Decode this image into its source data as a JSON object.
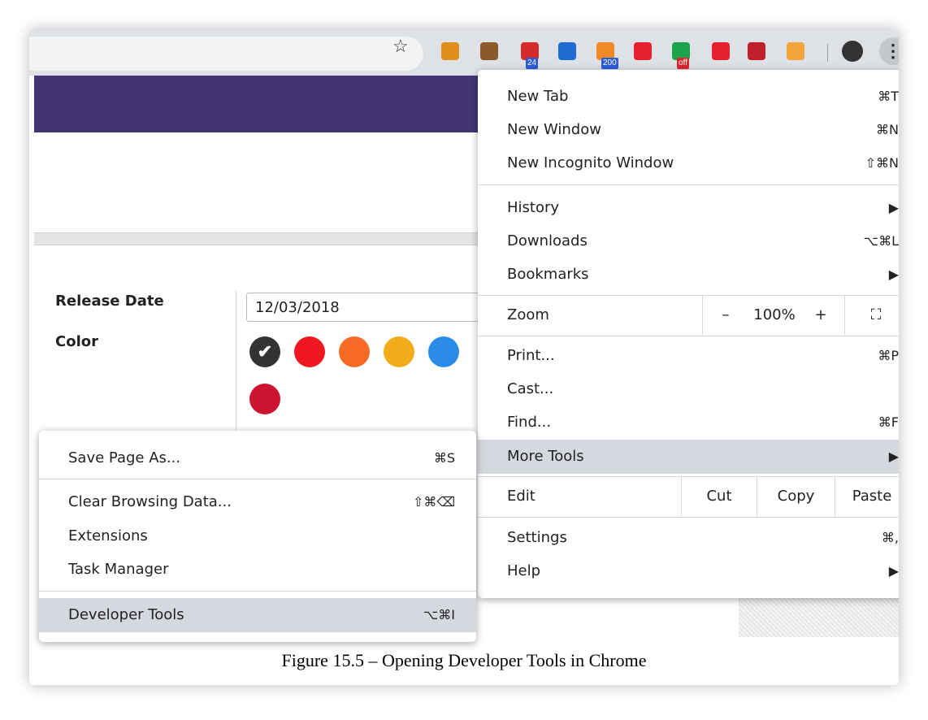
{
  "toolbar": {
    "extensions": [
      {
        "name": "extension-icon-1",
        "color": "#e0901a"
      },
      {
        "name": "extension-icon-2",
        "color": "#8a5a2a"
      },
      {
        "name": "extension-icon-3",
        "color": "#d62b2b",
        "badge": "24",
        "badge_color": "#2d5bd6"
      },
      {
        "name": "extension-icon-4",
        "color": "#1f6bd1"
      },
      {
        "name": "extension-icon-5",
        "color": "#f08a24",
        "badge": "200",
        "badge_color": "#2d5bd6"
      },
      {
        "name": "extension-icon-6",
        "color": "#e5202f"
      },
      {
        "name": "extension-icon-7",
        "color": "#1aa34a",
        "badge": "off",
        "badge_color": "#d8262c"
      },
      {
        "name": "extension-icon-8",
        "color": "#e5202f"
      },
      {
        "name": "extension-icon-9",
        "color": "#c0202a"
      },
      {
        "name": "extension-icon-10",
        "color": "#f3a43a"
      }
    ],
    "kebab_label": "⋮",
    "star_icon": "☆"
  },
  "page": {
    "release_date_label": "Release Date",
    "release_date_value": "12/03/2018",
    "color_label": "Color",
    "swatches": [
      "#333333",
      "#f01820",
      "#f66a28",
      "#f2ac1a",
      "#2b8ce8",
      "#cc1430"
    ]
  },
  "chrome_menu": {
    "new_tab": {
      "label": "New Tab",
      "shortcut": "⌘T"
    },
    "new_window": {
      "label": "New Window",
      "shortcut": "⌘N"
    },
    "new_incognito": {
      "label": "New Incognito Window",
      "shortcut": "⇧⌘N"
    },
    "history": {
      "label": "History",
      "shortcut": "▶"
    },
    "downloads": {
      "label": "Downloads",
      "shortcut": "⌥⌘L"
    },
    "bookmarks": {
      "label": "Bookmarks",
      "shortcut": "▶"
    },
    "zoom": {
      "label": "Zoom",
      "minus": "–",
      "value": "100%",
      "plus": "+",
      "fullscreen": "⛶"
    },
    "print": {
      "label": "Print...",
      "shortcut": "⌘P"
    },
    "cast": {
      "label": "Cast...",
      "shortcut": ""
    },
    "find": {
      "label": "Find...",
      "shortcut": "⌘F"
    },
    "more_tools": {
      "label": "More Tools",
      "shortcut": "▶"
    },
    "edit": {
      "label": "Edit",
      "cut": "Cut",
      "copy": "Copy",
      "paste": "Paste"
    },
    "settings": {
      "label": "Settings",
      "shortcut": "⌘,"
    },
    "help": {
      "label": "Help",
      "shortcut": "▶"
    }
  },
  "more_tools_menu": {
    "save_page": {
      "label": "Save Page As...",
      "shortcut": "⌘S"
    },
    "clear_browsing": {
      "label": "Clear Browsing Data...",
      "shortcut": "⇧⌘⌫"
    },
    "extensions": {
      "label": "Extensions",
      "shortcut": ""
    },
    "task_manager": {
      "label": "Task Manager",
      "shortcut": ""
    },
    "developer_tools": {
      "label": "Developer Tools",
      "shortcut": "⌥⌘I"
    }
  },
  "caption": "Figure 15.5 – Opening Developer Tools in Chrome"
}
